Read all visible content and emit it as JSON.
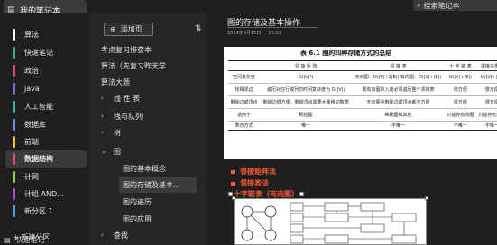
{
  "notebook": {
    "title": "我的笔记本"
  },
  "search": {
    "placeholder": "搜索笔记本"
  },
  "sections": [
    {
      "label": "算法",
      "color": "#ffffff"
    },
    {
      "label": "快速笔记",
      "color": "#36b37e"
    },
    {
      "label": "政治",
      "color": "#e0457b"
    },
    {
      "label": "java",
      "color": "#8e6ad8"
    },
    {
      "label": "人工智能",
      "color": "#2eb8a6"
    },
    {
      "label": "数据库",
      "color": "#6d8de8"
    },
    {
      "label": "前端",
      "color": "#f2c12e"
    },
    {
      "label": "数据结构",
      "color": "#e0457b"
    },
    {
      "label": "计网",
      "color": "#a4c93a"
    },
    {
      "label": "计组 AND...",
      "color": "#b04bd0"
    },
    {
      "label": "新分区 1",
      "color": "#4aa3e6"
    }
  ],
  "new_section": "新建分区",
  "bottom_notebook": "快速笔记",
  "pages_panel": {
    "add_page": "添加页",
    "items": [
      {
        "label": "考点复习排查本",
        "indent": 0,
        "chevron": ""
      },
      {
        "label": "算法（先复习昨天学...",
        "indent": 0,
        "chevron": ""
      },
      {
        "label": "算法大题",
        "indent": 0,
        "chevron": ""
      },
      {
        "label": "线 性 表",
        "indent": 0,
        "chevron": "›"
      },
      {
        "label": "栈与队列",
        "indent": 0,
        "chevron": "›"
      },
      {
        "label": "树",
        "indent": 0,
        "chevron": "›"
      },
      {
        "label": "图",
        "indent": 0,
        "chevron": "⌄"
      },
      {
        "label": "图的基本概念",
        "indent": 1,
        "chevron": ""
      },
      {
        "label": "图的存储及基本...",
        "indent": 1,
        "chevron": "",
        "selected": true
      },
      {
        "label": "图的遍历",
        "indent": 1,
        "chevron": ""
      },
      {
        "label": "图的应用",
        "indent": 1,
        "chevron": ""
      },
      {
        "label": "查找",
        "indent": 0,
        "chevron": "›"
      }
    ]
  },
  "page": {
    "title": "图的存储及基本操作",
    "date": "2024年8月15日",
    "time": "15:11"
  },
  "table_image": {
    "caption": "表 6.1  图的四种存储方式的总结",
    "headers": [
      "",
      "邻 接 矩 阵",
      "邻 接 表",
      "十 字 链 表",
      "邻接多重表"
    ],
    "rows": [
      [
        "空间复杂度",
        "O(|V|²)",
        "无向图：O(|V|+2|E|)  有向图：O(|V|+|E|)",
        "O(|V|+|E|)",
        "O(|V|+|E|)"
      ],
      [
        "找相邻边",
        "遍历对应行或列的时间复杂度为 O(|V|)",
        "找有向图的入度必须遍历整个邻接表",
        "很方便",
        "很方便"
      ],
      [
        "删除边或顶点",
        "删除边很方便，删除顶点需要大量移动数据",
        "无向图中删除边或顶点都不方便",
        "很方便",
        "很方便"
      ],
      [
        "适用于",
        "稠密图",
        "稀疏图和其他",
        "只能存有向图",
        "只能存无向图"
      ],
      [
        "表示方式",
        "唯一",
        "不唯一",
        "不唯一",
        "不唯一"
      ]
    ]
  },
  "bullets": [
    "邻接矩阵法",
    "邻接表法",
    "十字链表（有向图）"
  ],
  "colors": {
    "accent_red": "#ff5a3c",
    "selected_bg": "#3c3c3c"
  },
  "icons": {
    "notebook": "notebook-icon",
    "search": "search-icon",
    "add_page": "add-page-icon",
    "sort": "sort-icon"
  }
}
